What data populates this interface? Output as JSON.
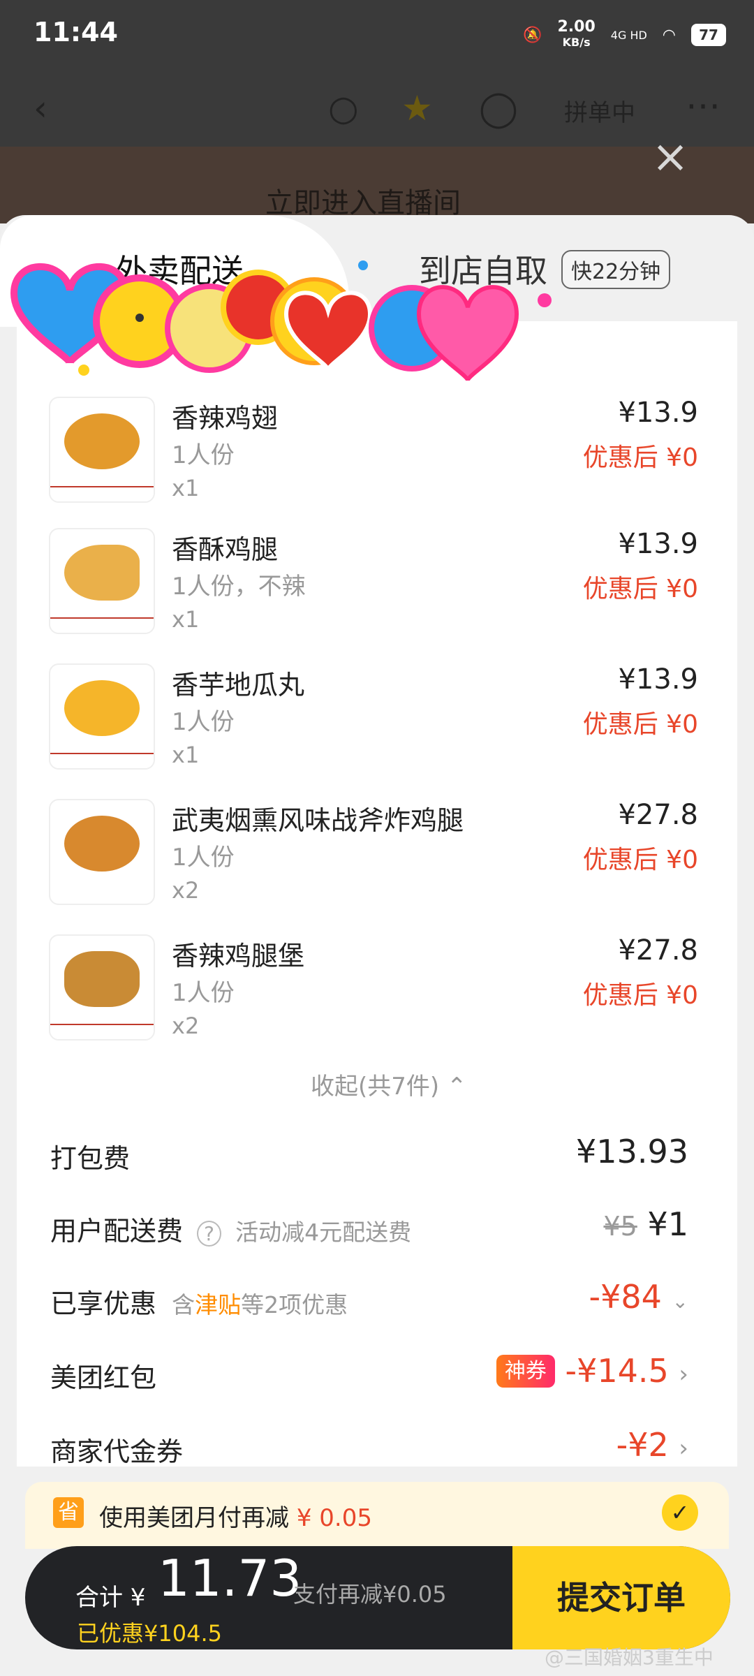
{
  "status": {
    "time": "11:44",
    "speed": "2.00",
    "speed_unit": "KB/s",
    "network": "4G HD",
    "battery": "77"
  },
  "nav": {
    "group_order": "拼单中"
  },
  "banner": {
    "text": "立即进入直播间"
  },
  "tabs": {
    "delivery": "外卖配送",
    "pickup": "到店自取",
    "pickup_badge": "快22分钟"
  },
  "items": [
    {
      "name": "香辣鸡翅",
      "spec": "1人份",
      "qty": "x1",
      "price": "¥13.9",
      "discount": "优惠后 ¥0"
    },
    {
      "name": "香酥鸡腿",
      "spec": "1人份，不辣",
      "qty": "x1",
      "price": "¥13.9",
      "discount": "优惠后 ¥0"
    },
    {
      "name": "香芋地瓜丸",
      "spec": "1人份",
      "qty": "x1",
      "price": "¥13.9",
      "discount": "优惠后 ¥0"
    },
    {
      "name": "武夷烟熏风味战斧炸鸡腿",
      "spec": "1人份",
      "qty": "x2",
      "price": "¥27.8",
      "discount": "优惠后 ¥0"
    },
    {
      "name": "香辣鸡腿堡",
      "spec": "1人份",
      "qty": "x2",
      "price": "¥27.8",
      "discount": "优惠后 ¥0"
    }
  ],
  "collapse": "收起(共7件)",
  "fees": {
    "packing_label": "打包费",
    "packing_value": "¥13.93",
    "delivery_label": "用户配送费",
    "delivery_note": "活动减4元配送费",
    "delivery_old": "¥5",
    "delivery_value": "¥1",
    "discount_label": "已享优惠",
    "discount_note_pre": "含",
    "discount_note_hl": "津贴",
    "discount_note_post": "等2项优惠",
    "discount_value": "-¥84",
    "redpack_label": "美团红包",
    "redpack_badge": "神券",
    "redpack_value": "-¥14.5",
    "voucher_label": "商家代金券",
    "voucher_value": "-¥2"
  },
  "monthly_pay": {
    "icon": "省",
    "text": "使用美团月付再减",
    "amount": "¥ 0.05"
  },
  "footer": {
    "total_label": "合计 ¥",
    "total_value": "11.73",
    "sub": "支付再减¥0.05",
    "saved": "已优惠¥104.5",
    "submit": "提交订单"
  },
  "watermark": "@三国婚姻3重生中",
  "colors": {
    "accent": "#ffd21e",
    "price_red": "#e8462a",
    "dark": "#222326"
  }
}
